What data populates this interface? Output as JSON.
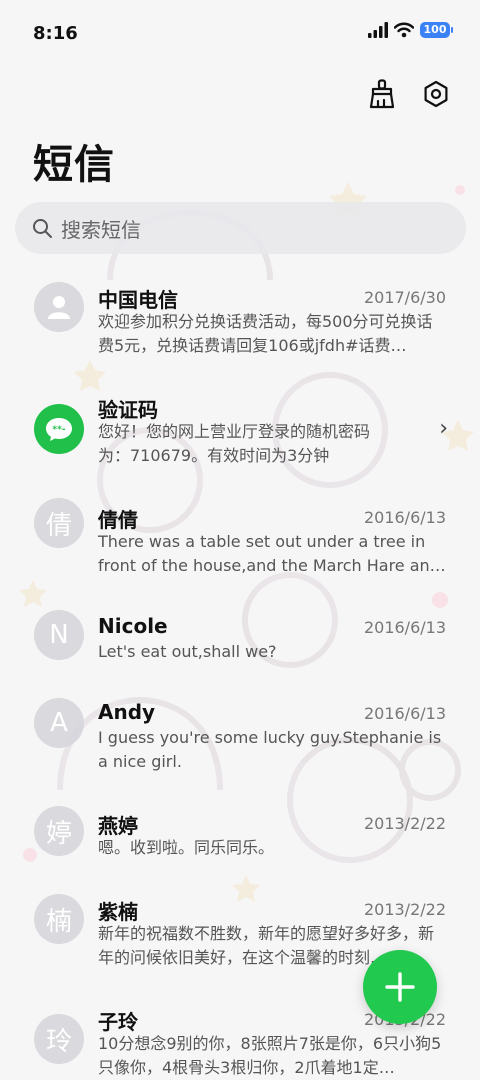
{
  "status": {
    "time": "8:16",
    "battery": "100"
  },
  "header": {
    "title": "短信"
  },
  "search": {
    "placeholder": "搜索短信"
  },
  "conversations": [
    {
      "avatar": "",
      "avatar_icon": "person-icon",
      "name": "中国电信",
      "date": "2017/6/30",
      "preview": "欢迎参加积分兑换话费活动，每500分可兑换话费5元，兑换话费请回复106或jfdh#话费…"
    },
    {
      "avatar": "",
      "avatar_icon": "message-bubble-icon",
      "name": "验证码",
      "date": "",
      "preview": "您好！您的网上营业厅登录的随机密码为：710679。有效时间为3分钟",
      "has_chevron": true
    },
    {
      "avatar": "倩",
      "name": "倩倩",
      "date": "2016/6/13",
      "preview": "There was a table set out under a tree in front of the house,and the March Hare an…"
    },
    {
      "avatar": "N",
      "name": "Nicole",
      "date": "2016/6/13",
      "preview": "Let's eat out,shall we?"
    },
    {
      "avatar": "A",
      "name": "Andy",
      "date": "2016/6/13",
      "preview": "I guess you're some lucky guy.Stephanie is a nice girl."
    },
    {
      "avatar": "婷",
      "name": "燕婷",
      "date": "2013/2/22",
      "preview": "嗯。收到啦。同乐同乐。"
    },
    {
      "avatar": "楠",
      "name": "紫楠",
      "date": "2013/2/22",
      "preview": "新年的祝福数不胜数，新年的愿望好多好多，新年的问候依旧美好，在这个温馨的时刻…"
    },
    {
      "avatar": "玲",
      "name": "子玲",
      "date": "2013/2/22",
      "preview": "10分想念9别的你，8张照片7张是你，6只小狗5只像你，4根骨头3根归你，2爪着地1定…"
    }
  ],
  "colors": {
    "accent": "#22c94f",
    "battery": "#3b82f6"
  },
  "icons": {
    "clean": "broom-icon",
    "settings": "settings-icon",
    "search": "search-icon",
    "compose": "plus-icon"
  }
}
